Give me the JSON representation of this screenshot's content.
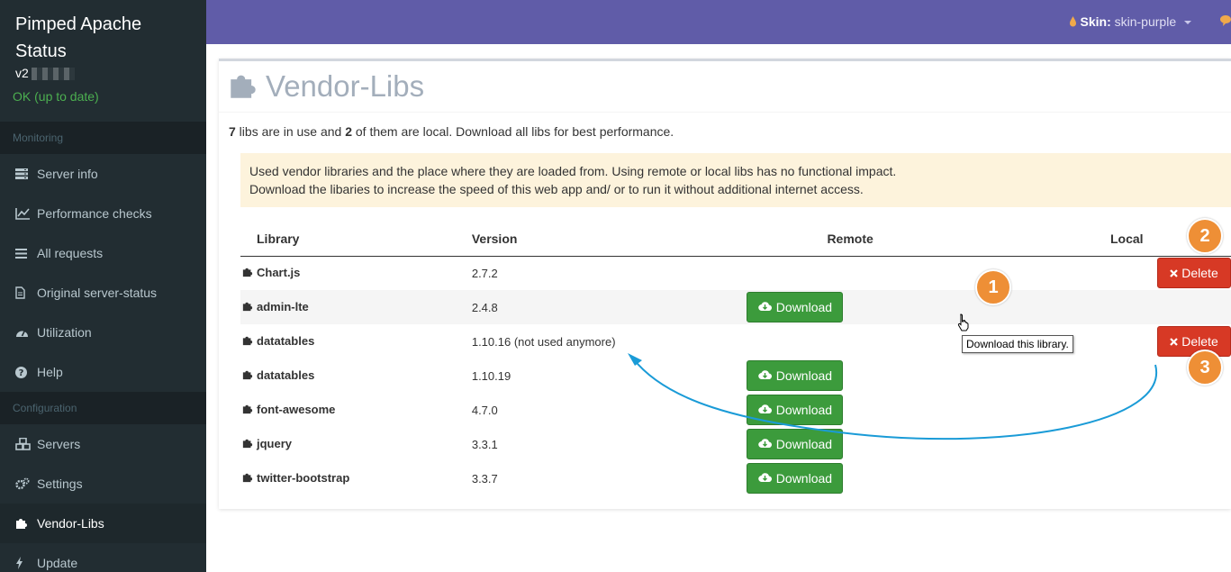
{
  "sidebar": {
    "title_line1": "Pimped Apache",
    "title_line2": "Status",
    "version": "v2",
    "status": "OK (up to date)",
    "section_monitoring": "Monitoring",
    "section_configuration": "Configuration",
    "items": [
      {
        "label": "Server info",
        "icon": "server-icon"
      },
      {
        "label": "Performance checks",
        "icon": "line-chart-icon"
      },
      {
        "label": "All requests",
        "icon": "list-icon"
      },
      {
        "label": "Original server-status",
        "icon": "document-icon"
      },
      {
        "label": "Utilization",
        "icon": "dashboard-icon"
      },
      {
        "label": "Help",
        "icon": "help-icon"
      },
      {
        "label": "Servers",
        "icon": "cubes-icon"
      },
      {
        "label": "Settings",
        "icon": "cogs-icon"
      },
      {
        "label": "Vendor-Libs",
        "icon": "puzzle-icon"
      },
      {
        "label": "Update",
        "icon": "bolt-icon"
      }
    ]
  },
  "header": {
    "skin_label": "Skin:",
    "skin_value": "skin-purple"
  },
  "main": {
    "title": "Vendor-Libs",
    "summary": {
      "count_total": "7",
      "text_1": " libs are in use and ",
      "count_local": "2",
      "text_2": " of them are local. Download all libs for best performance."
    },
    "callout_line1": "Used vendor libraries and the place where they are loaded from. Using remote or local libs has no functional impact.",
    "callout_line2": "Download the libaries to increase the speed of this web app and/ or to run it without additional internet access.",
    "columns": {
      "library": "Library",
      "version": "Version",
      "remote": "Remote",
      "local": "Local"
    },
    "download_label": "Download",
    "delete_label": "Delete",
    "tooltip": "Download this library.",
    "rows": [
      {
        "name": "Chart.js",
        "version": "2.7.2"
      },
      {
        "name": "admin-lte",
        "version": "2.4.8"
      },
      {
        "name": "datatables",
        "version": "1.10.16 (not used anymore)"
      },
      {
        "name": "datatables",
        "version": "1.10.19"
      },
      {
        "name": "font-awesome",
        "version": "4.7.0"
      },
      {
        "name": "jquery",
        "version": "3.3.1"
      },
      {
        "name": "twitter-bootstrap",
        "version": "3.3.7"
      }
    ],
    "badges": [
      "1",
      "2",
      "3"
    ]
  },
  "colors": {
    "header_bg": "#605ca8",
    "sidebar_bg": "#222d32",
    "success": "#3c9b3c",
    "danger": "#d73925",
    "badge": "#ee8f36",
    "arrow": "#1a9bd7"
  }
}
